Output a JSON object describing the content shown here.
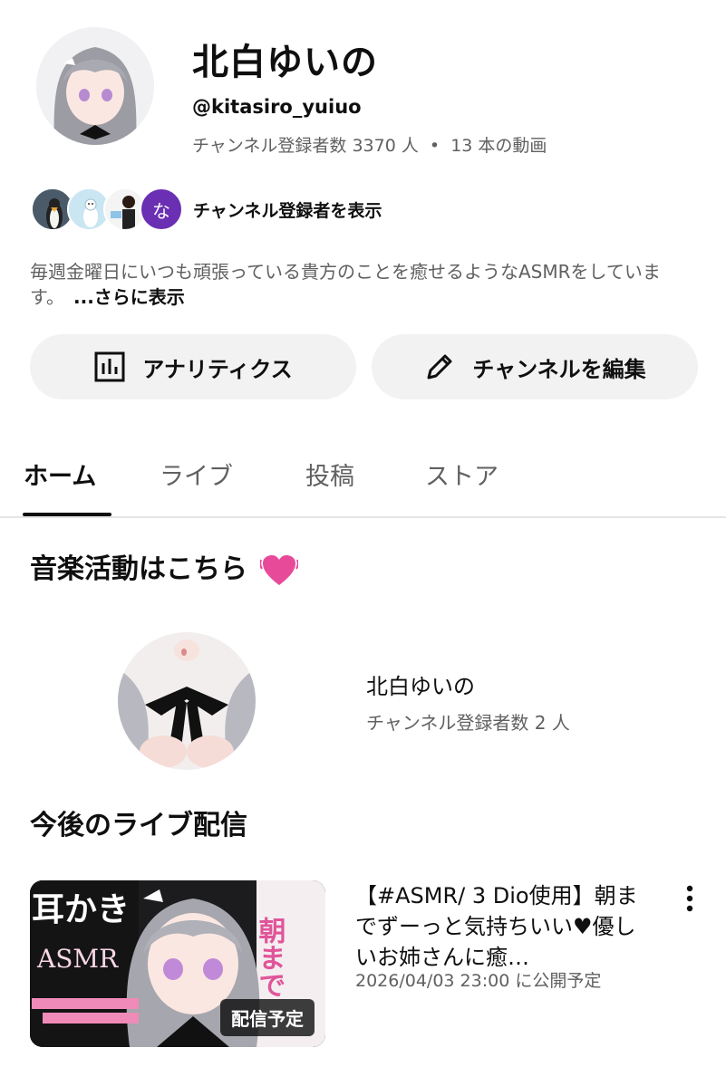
{
  "header": {
    "channel_name": "北白ゆいの",
    "handle": "@kitasiro_yuiuo",
    "subscribers": "チャンネル登録者数 3370 人",
    "separator": "•",
    "videos": "13 本の動画",
    "sub_avatar_letter": "な",
    "subscribers_link": "チャンネル登録者を表示",
    "description": "毎週金曜日にいつも頑張っている貴方のことを癒せるようなASMRをしています。",
    "more": "...さらに表示"
  },
  "actions": {
    "analytics_label": "アナリティクス",
    "edit_label": "チャンネルを編集"
  },
  "tabs": [
    {
      "label": "ホーム",
      "active": true
    },
    {
      "label": "ライブ",
      "active": false
    },
    {
      "label": "投稿",
      "active": false
    },
    {
      "label": "ストア",
      "active": false
    }
  ],
  "music_section": {
    "title": "音楽活動はこちら",
    "channel_name": "北白ゆいの",
    "subscribers": "チャンネル登録者数 2 人"
  },
  "live_section": {
    "title": "今後のライブ配信",
    "video_title": "【#ASMR/ 3 Dio使用】朝までずーっと気持ちいい♥優しいお姉さんに癒…",
    "schedule": "2026/04/03 23:00 に公開予定",
    "badge": "配信予定",
    "thumb_text_left": "耳かき",
    "thumb_text_asmr": "ASMR",
    "thumb_text_right": "朝まで"
  },
  "colors": {
    "text_primary": "#0f0f0f",
    "text_secondary": "#606060",
    "button_bg": "#f2f2f2",
    "accent_purple": "#6a2fb2",
    "heart_pink": "#e84a9a"
  }
}
